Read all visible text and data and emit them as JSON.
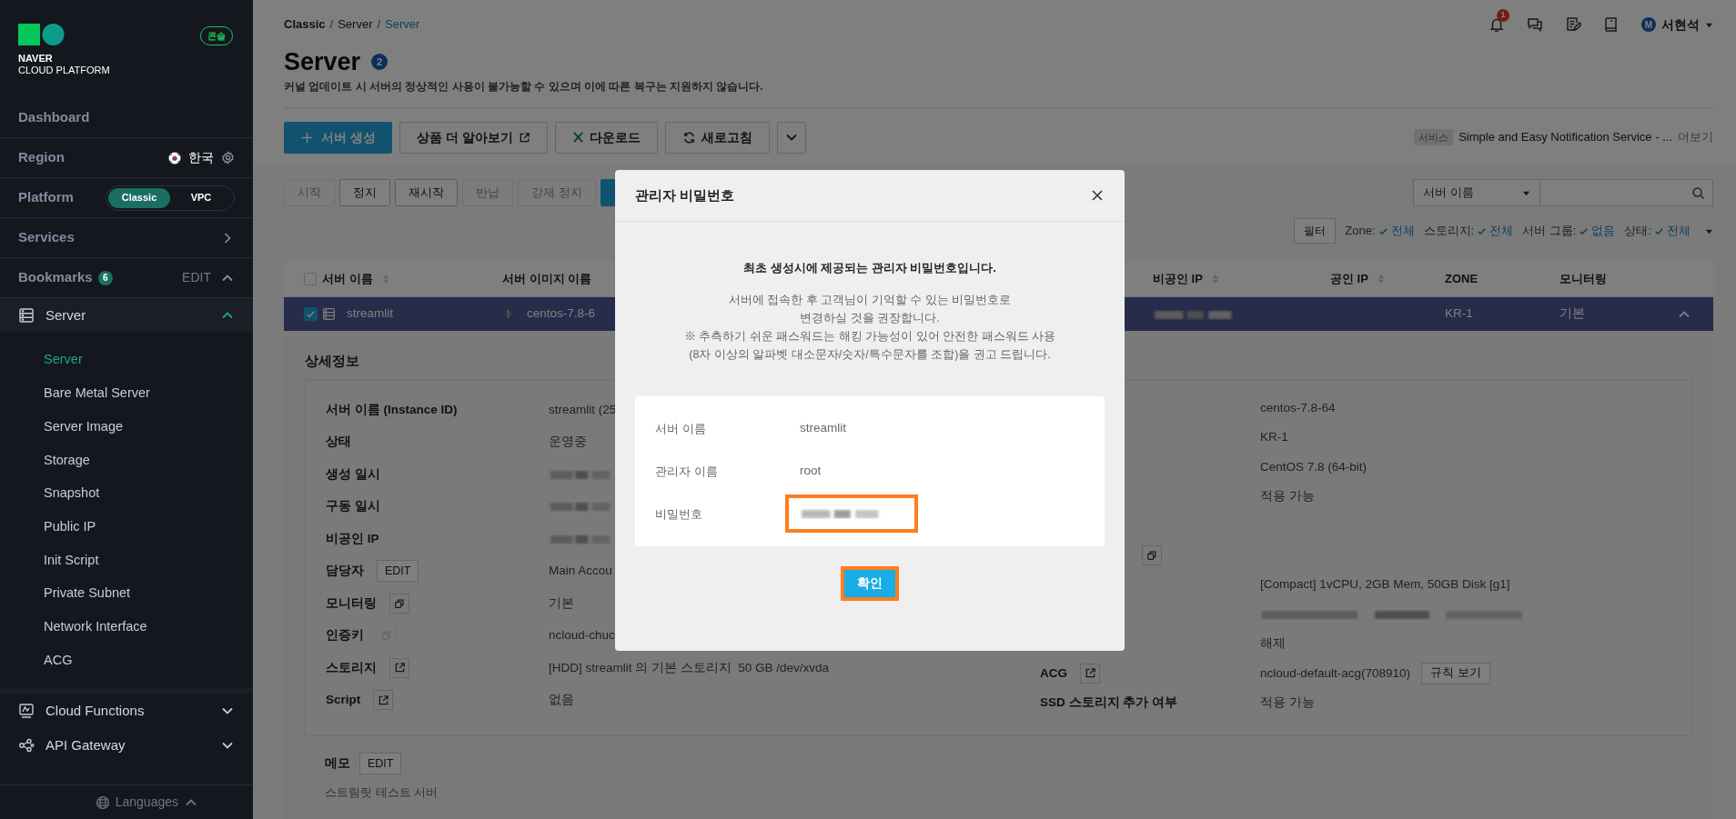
{
  "sidebar": {
    "logo": {
      "line1": "NAVER",
      "line2": "CLOUD PLATFORM"
    },
    "console_badge": "콘솔",
    "nav": [
      {
        "kind": "link",
        "label": "Dashboard"
      },
      {
        "kind": "region",
        "label": "Region",
        "value": "한국"
      },
      {
        "kind": "platform",
        "label": "Platform",
        "options": [
          {
            "label": "Classic",
            "selected": true
          },
          {
            "label": "VPC",
            "selected": false
          }
        ]
      },
      {
        "kind": "services",
        "label": "Services"
      },
      {
        "kind": "bookmarks",
        "label": "Bookmarks",
        "count": "6",
        "action": "EDIT",
        "expanded": true
      }
    ],
    "groups": [
      {
        "label": "Server",
        "expanded": true,
        "children": [
          {
            "label": "Server",
            "selected": true
          },
          {
            "label": "Bare Metal Server",
            "selected": false
          },
          {
            "label": "Server Image",
            "selected": false
          },
          {
            "label": "Storage",
            "selected": false
          },
          {
            "label": "Snapshot",
            "selected": false
          },
          {
            "label": "Public IP",
            "selected": false
          },
          {
            "label": "Init Script",
            "selected": false
          },
          {
            "label": "Private Subnet",
            "selected": false
          },
          {
            "label": "Network Interface",
            "selected": false
          },
          {
            "label": "ACG",
            "selected": false
          }
        ]
      },
      {
        "label": "Cloud Functions",
        "expanded": false
      },
      {
        "label": "API Gateway",
        "expanded": false
      }
    ],
    "languages": "Languages"
  },
  "header": {
    "breadcrumb": [
      {
        "label": "Classic",
        "separator": "/",
        "selected": false
      },
      {
        "label": "Server",
        "separator": "/",
        "selected": false
      },
      {
        "label": "Server",
        "selected": true
      }
    ],
    "notifications": "1",
    "user_initial": "M",
    "user": "서현석"
  },
  "page": {
    "title": "Server",
    "count": "2",
    "notice": "커널 업데이트 시 서버의 정상적인 사용이 불가능할 수 있으며 이에 따른 복구는 지원하지 않습니다."
  },
  "toolbar": [
    {
      "kind": "primary",
      "label": "서버 생성"
    },
    {
      "kind": "external",
      "label": "상품 더 알아보기"
    },
    {
      "kind": "excel",
      "label": "다운로드"
    },
    {
      "kind": "refresh",
      "label": "새로고침"
    },
    {
      "kind": "more"
    }
  ],
  "service_notice": {
    "tag": "서비스",
    "text": "Simple and Easy Notification Service - ...",
    "link": "더보기"
  },
  "actions": [
    {
      "kind": "plain",
      "label": "시작",
      "disabled": true
    },
    {
      "kind": "plain",
      "label": "정지",
      "disabled": false
    },
    {
      "kind": "plain",
      "label": "재시작",
      "disabled": false
    },
    {
      "kind": "plain",
      "label": "반납",
      "disabled": true
    },
    {
      "kind": "plain",
      "label": "강제 정지",
      "disabled": true
    },
    {
      "kind": "primary"
    }
  ],
  "search": {
    "select": "서버 이름"
  },
  "filters": {
    "button": "필터",
    "items": [
      {
        "label": "Zone:",
        "value": "전체"
      },
      {
        "label": "스토리지:",
        "value": "전체"
      },
      {
        "label": "서버 그룹:",
        "value": "없음"
      },
      {
        "label": "상태:",
        "value": "전체"
      }
    ]
  },
  "table": {
    "select_all": {
      "checked": false
    },
    "columns": [
      {
        "label": "서버 이름",
        "sortable": true
      },
      {
        "label": "서버 이미지 이름",
        "sortable": false
      },
      {
        "label": "비공인 IP",
        "sortable": true
      },
      {
        "label": "공인 IP",
        "sortable": true
      },
      {
        "label": "ZONE",
        "sortable": false
      },
      {
        "label": "모니터링",
        "sortable": false
      }
    ],
    "rows": [
      {
        "selected": true,
        "checked": true,
        "expanded": true,
        "name": "streamlit",
        "image": "centos-7.8-6",
        "zone": "KR-1",
        "monitoring": "기본"
      }
    ]
  },
  "details": {
    "title": "상세정보",
    "left": [
      {
        "label": "서버 이름 (Instance ID)",
        "value": "streamlit (25"
      },
      {
        "label": "상태",
        "value": "운영중"
      },
      {
        "label": "생성 일시",
        "redacted": true
      },
      {
        "label": "구동 일시",
        "redacted": true
      },
      {
        "label": "비공인 IP",
        "redacted": true
      },
      {
        "label": "담당자",
        "button": "EDIT",
        "value": "Main Accou"
      },
      {
        "label": "모니터링",
        "kind": "copy",
        "icon_disabled": false,
        "value": "기본"
      },
      {
        "label": "인증키",
        "kind": "copy",
        "icon_disabled": true,
        "value": "ncloud-chuc"
      },
      {
        "label": "스토리지",
        "kind": "link",
        "icon_disabled": false,
        "value": "[HDD] streamlit 의 기본 스토리지  50 GB /dev/xvda"
      },
      {
        "label": "Script",
        "kind": "link",
        "icon_disabled": false,
        "value": "없음"
      }
    ],
    "right": [
      {
        "kind": "value",
        "value": "centos-7.8-64"
      },
      {
        "kind": "value",
        "value": "KR-1"
      },
      {
        "kind": "value",
        "value": "CentOS 7.8 (64-bit)"
      },
      {
        "kind": "value",
        "value": "적용 가능"
      },
      {
        "kind": "blank"
      },
      {
        "kind": "copy"
      },
      {
        "kind": "value",
        "value": "[Compact] 1vCPU, 2GB Mem, 50GB Disk [g1]"
      },
      {
        "kind": "redacted"
      },
      {
        "kind": "value",
        "value": "해제"
      },
      {
        "kind": "labeled_link",
        "label": "ACG",
        "value": "ncloud-default-acg(708910)",
        "button": "규칙 보기"
      },
      {
        "kind": "labeled",
        "label": "SSD 스토리지 추가 여부",
        "value": "적용 가능"
      }
    ],
    "memo": {
      "label": "메모",
      "button": "EDIT",
      "text": "스트림릿 테스트 서버"
    }
  },
  "modal": {
    "title": "관리자 비밀번호",
    "heading": "최초 생성시에 제공되는 관리자 비밀번호입니다.",
    "lines": [
      "서버에 접속한 후 고객님이 기억할 수 있는 비밀번호로",
      "변경하실 것을 권장합니다.",
      "※ 추측하기 쉬운 패스워드는 해킹 가능성이 있어 안전한 패스워드 사용",
      "(8자 이상의 알파벳 대소문자/숫자/특수문자를 조합)을 권고 드립니다."
    ],
    "fields": [
      {
        "label": "서버 이름",
        "value": "streamlit",
        "highlighted": false
      },
      {
        "label": "관리자 이름",
        "value": "root",
        "highlighted": false
      },
      {
        "label": "비밀번호",
        "redacted": true,
        "highlighted": true
      }
    ],
    "confirm": {
      "label": "확인",
      "highlighted": true
    }
  }
}
